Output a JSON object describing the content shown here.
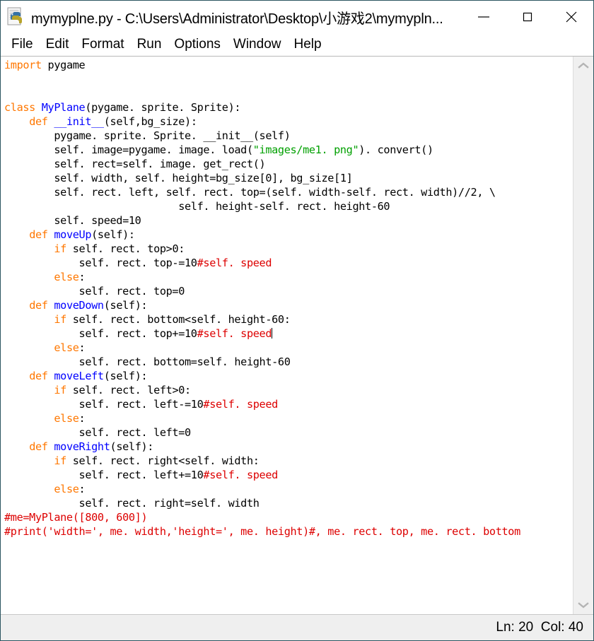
{
  "window": {
    "title": "mymyplne.py - C:\\Users\\Administrator\\Desktop\\小游戏2\\mymypln...",
    "icon_name": "python-file-icon",
    "controls": {
      "minimize_label": "Minimize",
      "maximize_label": "Maximize",
      "close_label": "Close"
    },
    "border_color": "#2c5560"
  },
  "menubar": {
    "items": [
      {
        "label": "File"
      },
      {
        "label": "Edit"
      },
      {
        "label": "Format"
      },
      {
        "label": "Run"
      },
      {
        "label": "Options"
      },
      {
        "label": "Window"
      },
      {
        "label": "Help"
      }
    ]
  },
  "scrollbar": {
    "up_arrow_icon": "chevron-up-icon",
    "down_arrow_icon": "chevron-down-icon"
  },
  "statusbar": {
    "line_col": "Ln: 20  Col: 40",
    "line": 20,
    "col": 40
  },
  "syntax_colors": {
    "keyword": "#ff7700",
    "definition": "#0000ff",
    "string": "#00a000",
    "comment": "#dd0000",
    "text": "#000000",
    "background": "#ffffff"
  },
  "editor": {
    "caret_line": 20,
    "lines": [
      [
        {
          "t": "import",
          "c": "kw"
        },
        {
          "t": " pygame",
          "c": ""
        }
      ],
      [],
      [],
      [
        {
          "t": "class ",
          "c": "kw"
        },
        {
          "t": "MyPlane",
          "c": "def"
        },
        {
          "t": "(pygame. sprite. Sprite):",
          "c": ""
        }
      ],
      [
        {
          "t": "    ",
          "c": ""
        },
        {
          "t": "def ",
          "c": "kw"
        },
        {
          "t": "__init__",
          "c": "def"
        },
        {
          "t": "(self,bg_size):",
          "c": ""
        }
      ],
      [
        {
          "t": "        pygame. sprite. Sprite. __init__(self)",
          "c": ""
        }
      ],
      [
        {
          "t": "        self. image=pygame. image. load(",
          "c": ""
        },
        {
          "t": "\"images/me1. png\"",
          "c": "str"
        },
        {
          "t": "). convert()",
          "c": ""
        }
      ],
      [
        {
          "t": "        self. rect=self. image. get_rect()",
          "c": ""
        }
      ],
      [
        {
          "t": "        self. width, self. height=bg_size[0], bg_size[1]",
          "c": ""
        }
      ],
      [
        {
          "t": "        self. rect. left, self. rect. top=(self. width-self. rect. width)//2, \\",
          "c": ""
        }
      ],
      [
        {
          "t": "                            self. height-self. rect. height-60",
          "c": ""
        }
      ],
      [
        {
          "t": "        self. speed=10",
          "c": ""
        }
      ],
      [
        {
          "t": "    ",
          "c": ""
        },
        {
          "t": "def ",
          "c": "kw"
        },
        {
          "t": "moveUp",
          "c": "def"
        },
        {
          "t": "(self):",
          "c": ""
        }
      ],
      [
        {
          "t": "        ",
          "c": ""
        },
        {
          "t": "if",
          "c": "kw"
        },
        {
          "t": " self. rect. top>0:",
          "c": ""
        }
      ],
      [
        {
          "t": "            self. rect. top-=10",
          "c": ""
        },
        {
          "t": "#self. speed",
          "c": "cmt"
        }
      ],
      [
        {
          "t": "        ",
          "c": ""
        },
        {
          "t": "else",
          "c": "kw"
        },
        {
          "t": ":",
          "c": ""
        }
      ],
      [
        {
          "t": "            self. rect. top=0",
          "c": ""
        }
      ],
      [
        {
          "t": "    ",
          "c": ""
        },
        {
          "t": "def ",
          "c": "kw"
        },
        {
          "t": "moveDown",
          "c": "def"
        },
        {
          "t": "(self):",
          "c": ""
        }
      ],
      [
        {
          "t": "        ",
          "c": ""
        },
        {
          "t": "if",
          "c": "kw"
        },
        {
          "t": " self. rect. bottom<self. height-60:",
          "c": ""
        }
      ],
      [
        {
          "t": "            self. rect. top+=10",
          "c": ""
        },
        {
          "t": "#self. speed",
          "c": "cmt"
        },
        {
          "t": "",
          "c": "caret"
        }
      ],
      [
        {
          "t": "        ",
          "c": ""
        },
        {
          "t": "else",
          "c": "kw"
        },
        {
          "t": ":",
          "c": ""
        }
      ],
      [
        {
          "t": "            self. rect. bottom=self. height-60",
          "c": ""
        }
      ],
      [
        {
          "t": "    ",
          "c": ""
        },
        {
          "t": "def ",
          "c": "kw"
        },
        {
          "t": "moveLeft",
          "c": "def"
        },
        {
          "t": "(self):",
          "c": ""
        }
      ],
      [
        {
          "t": "        ",
          "c": ""
        },
        {
          "t": "if",
          "c": "kw"
        },
        {
          "t": " self. rect. left>0:",
          "c": ""
        }
      ],
      [
        {
          "t": "            self. rect. left-=10",
          "c": ""
        },
        {
          "t": "#self. speed",
          "c": "cmt"
        }
      ],
      [
        {
          "t": "        ",
          "c": ""
        },
        {
          "t": "else",
          "c": "kw"
        },
        {
          "t": ":",
          "c": ""
        }
      ],
      [
        {
          "t": "            self. rect. left=0",
          "c": ""
        }
      ],
      [
        {
          "t": "    ",
          "c": ""
        },
        {
          "t": "def ",
          "c": "kw"
        },
        {
          "t": "moveRight",
          "c": "def"
        },
        {
          "t": "(self):",
          "c": ""
        }
      ],
      [
        {
          "t": "        ",
          "c": ""
        },
        {
          "t": "if",
          "c": "kw"
        },
        {
          "t": " self. rect. right<self. width:",
          "c": ""
        }
      ],
      [
        {
          "t": "            self. rect. left+=10",
          "c": ""
        },
        {
          "t": "#self. speed",
          "c": "cmt"
        }
      ],
      [
        {
          "t": "        ",
          "c": ""
        },
        {
          "t": "else",
          "c": "kw"
        },
        {
          "t": ":",
          "c": ""
        }
      ],
      [
        {
          "t": "            self. rect. right=self. width",
          "c": ""
        }
      ],
      [
        {
          "t": "#me=MyPlane([800, 600])",
          "c": "cmt"
        }
      ],
      [
        {
          "t": "#print('width=', me. width,'height=', me. height)#, me. rect. top, me. rect. bottom",
          "c": "cmt"
        }
      ]
    ]
  }
}
